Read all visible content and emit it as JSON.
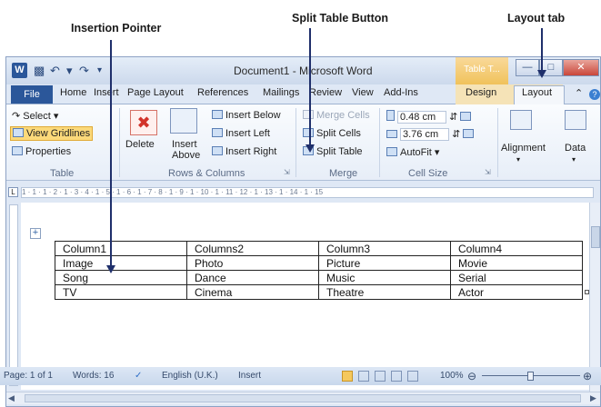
{
  "annotations": {
    "insertion_pointer": "Insertion Pointer",
    "split_table_button": "Split Table Button",
    "layout_tab": "Layout tab"
  },
  "window": {
    "title": "Document1 - Microsoft Word",
    "context_tab_title": "Table T...",
    "quick_access": [
      "save-icon",
      "undo-icon",
      "redo-icon",
      "customize-icon"
    ]
  },
  "tabs": {
    "file": "File",
    "home": "Home",
    "insert": "Insert",
    "page_layout": "Page Layout",
    "references": "References",
    "mailings": "Mailings",
    "review": "Review",
    "view": "View",
    "add_ins": "Add-Ins",
    "design": "Design",
    "layout": "Layout"
  },
  "ribbon": {
    "table_group": {
      "select": "Select",
      "view_gridlines": "View Gridlines",
      "properties": "Properties",
      "label": "Table"
    },
    "rows_columns_group": {
      "delete": "Delete",
      "insert_above_1": "Insert",
      "insert_above_2": "Above",
      "insert_below": "Insert Below",
      "insert_left": "Insert Left",
      "insert_right": "Insert Right",
      "label": "Rows & Columns"
    },
    "merge_group": {
      "merge_cells": "Merge Cells",
      "split_cells": "Split Cells",
      "split_table": "Split Table",
      "label": "Merge"
    },
    "cell_size_group": {
      "height": "0.48 cm",
      "width": "3.76 cm",
      "autofit": "AutoFit",
      "label": "Cell Size"
    },
    "alignment": "Alignment",
    "data": "Data"
  },
  "ruler_text": "1 · 1 · 1 · 2 · 1 · 3 · 4 · 1 · 5 · 1 · 6 · 1 · 7 · 8 · 1 · 9 · 1 · 10 · 1 · 11 · 12 · 1 · 13 · 1 · 14 · 1 · 15",
  "table": {
    "rows": [
      [
        "Column1",
        "Columns2",
        "Column3",
        "Column4"
      ],
      [
        "Image",
        "Photo",
        "Picture",
        "Movie"
      ],
      [
        "Song",
        "Dance",
        "Music",
        "Serial"
      ],
      [
        "TV",
        "Cinema",
        "Theatre",
        "Actor"
      ]
    ]
  },
  "status": {
    "page": "Page: 1 of 1",
    "words": "Words: 16",
    "language": "English (U.K.)",
    "mode": "Insert",
    "zoom": "100%"
  }
}
